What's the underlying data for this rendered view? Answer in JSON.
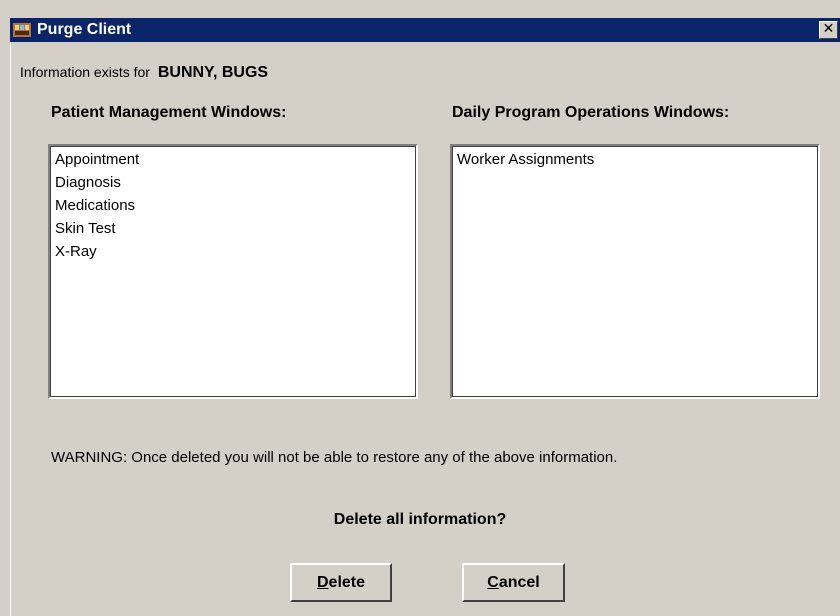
{
  "window": {
    "title": "Purge Client",
    "close_glyph": "✕"
  },
  "info": {
    "prefix": "Information exists for",
    "client_name": "BUNNY, BUGS"
  },
  "patient_management": {
    "heading": "Patient Management Windows:",
    "items": [
      "Appointment",
      "Diagnosis",
      "Medications",
      "Skin Test",
      "X-Ray"
    ]
  },
  "daily_operations": {
    "heading": "Daily Program Operations Windows:",
    "items": [
      "Worker Assignments"
    ]
  },
  "warning": "WARNING:  Once deleted you will not be able to restore any of the above information.",
  "question": "Delete all information?",
  "buttons": {
    "delete": {
      "mnemonic": "D",
      "rest": "elete"
    },
    "cancel": {
      "mnemonic": "C",
      "rest": "ancel"
    }
  },
  "icons": {
    "app": "app-icon",
    "close": "close-icon"
  }
}
